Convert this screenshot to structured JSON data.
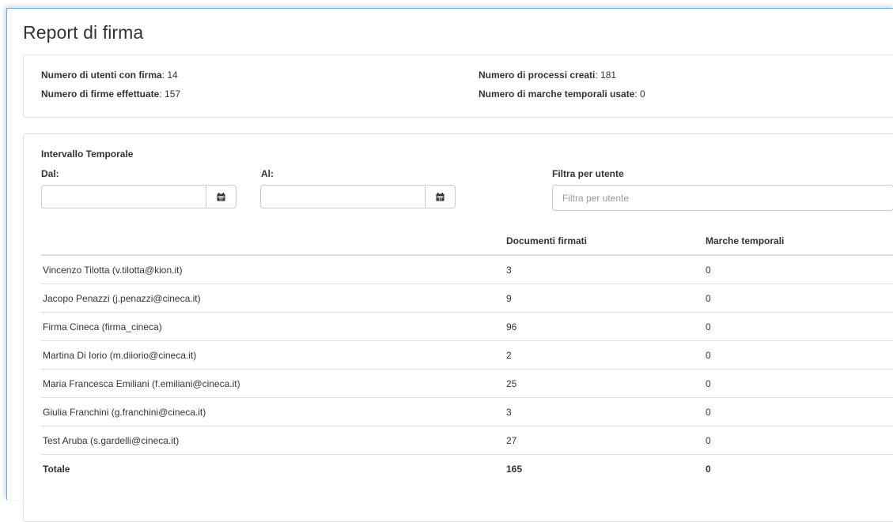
{
  "page": {
    "title": "Report di firma"
  },
  "summary": {
    "users_label": "Numero di utenti con firma",
    "users_value": ": 14",
    "signatures_label": "Numero di firme effettuate",
    "signatures_value": ": 157",
    "processes_label": "Numero di processi creati",
    "processes_value": ": 181",
    "timestamps_label": "Numero di marche temporali usate",
    "timestamps_value": ": 0"
  },
  "filters": {
    "interval_label": "Intervallo Temporale",
    "from_label": "Dal:",
    "from_value": "",
    "to_label": "Al:",
    "to_value": "",
    "user_filter_label": "Filtra per utente",
    "user_filter_placeholder": "Filtra per utente",
    "calendar_icon": "calendar-icon"
  },
  "table": {
    "headers": [
      "",
      "Documenti firmati",
      "Marche temporali"
    ],
    "rows": [
      {
        "user": "Vincenzo Tilotta (v.tilotta@kion.it)",
        "signed": "3",
        "timestamps": "0"
      },
      {
        "user": "Jacopo Penazzi (j.penazzi@cineca.it)",
        "signed": "9",
        "timestamps": "0"
      },
      {
        "user": "Firma Cineca (firma_cineca)",
        "signed": "96",
        "timestamps": "0"
      },
      {
        "user": "Martina Di Iorio (m.diiorio@cineca.it)",
        "signed": "2",
        "timestamps": "0"
      },
      {
        "user": "Maria Francesca Emiliani (f.emiliani@cineca.it)",
        "signed": "25",
        "timestamps": "0"
      },
      {
        "user": "Giulia Franchini (g.franchini@cineca.it)",
        "signed": "3",
        "timestamps": "0"
      },
      {
        "user": "Test Aruba (s.gardelli@cineca.it)",
        "signed": "27",
        "timestamps": "0"
      }
    ],
    "total": {
      "label": "Totale",
      "signed": "165",
      "timestamps": "0"
    }
  },
  "colors": {
    "text": "#333333",
    "border": "#dddddd",
    "frame_accent": "#7fa3d4"
  }
}
